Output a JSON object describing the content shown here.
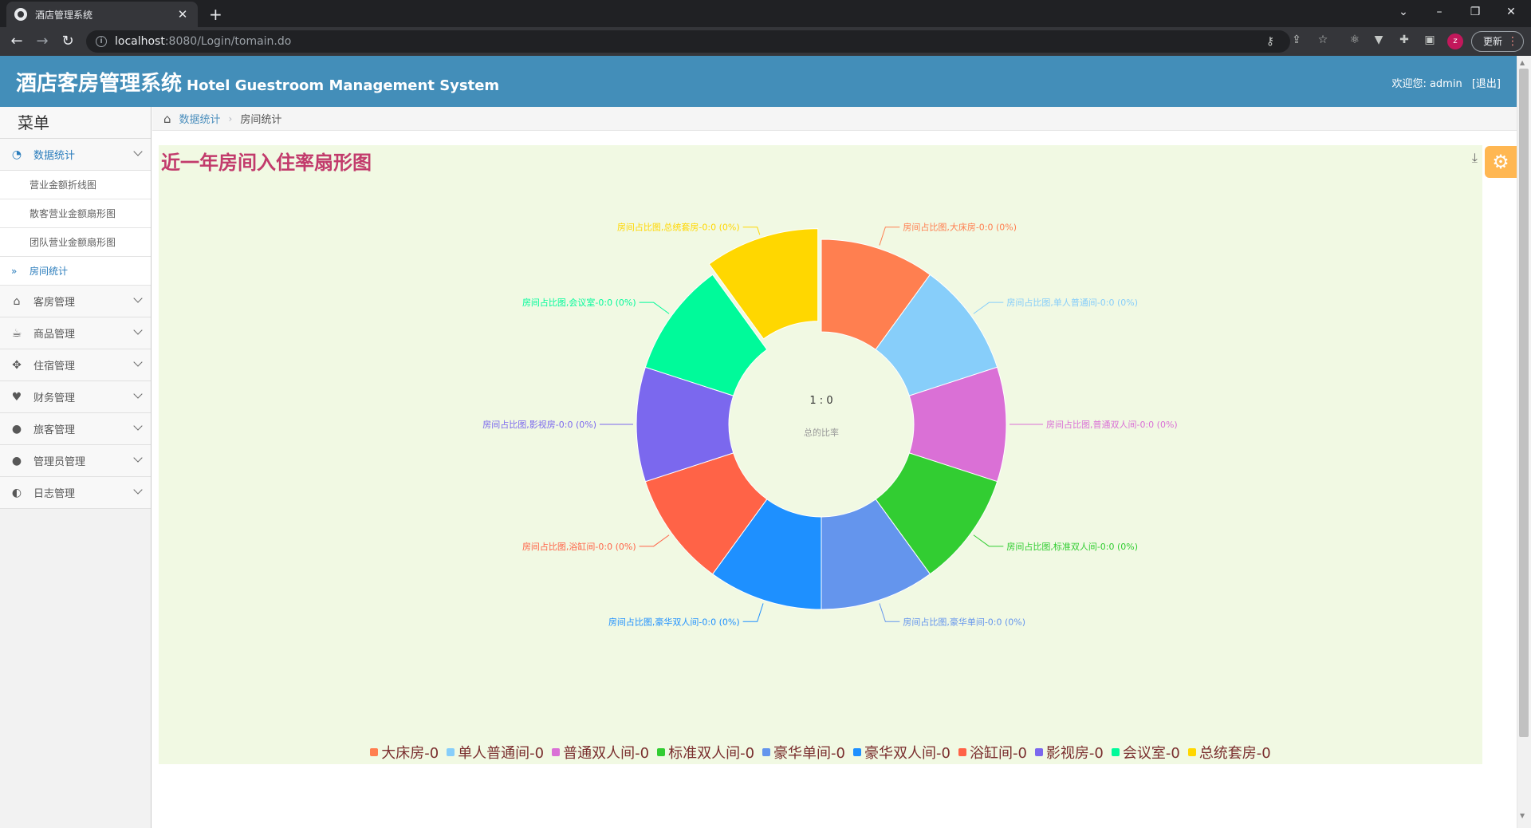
{
  "browser": {
    "tab_title": "酒店管理系统",
    "tab_close": "✕",
    "new_tab": "+",
    "url_host": "localhost",
    "url_path": ":8080/Login/tomain.do",
    "update_label": "更新",
    "profile_initial": "z"
  },
  "header": {
    "title": "酒店客房管理系统",
    "subtitle": "Hotel Guestroom Management System",
    "welcome": "欢迎您:",
    "username": "admin",
    "logout": "[退出]"
  },
  "sidebar": {
    "menu_title": "菜单",
    "items": [
      {
        "label": "数据统计",
        "icon": "dashboard-icon",
        "active": true
      },
      {
        "label": "客房管理",
        "icon": "home-icon"
      },
      {
        "label": "商品管理",
        "icon": "coffee-icon"
      },
      {
        "label": "住宿管理",
        "icon": "move-icon"
      },
      {
        "label": "财务管理",
        "icon": "heart-icon"
      },
      {
        "label": "旅客管理",
        "icon": "user-icon"
      },
      {
        "label": "管理员管理",
        "icon": "user-icon"
      },
      {
        "label": "日志管理",
        "icon": "adjust-icon"
      }
    ],
    "subitems": [
      {
        "label": "营业金额折线图"
      },
      {
        "label": "散客营业金额扇形图"
      },
      {
        "label": "团队营业金额扇形图"
      },
      {
        "label": "房间统计",
        "active": true
      }
    ]
  },
  "breadcrumb": {
    "home": "数据统计",
    "current": "房间统计"
  },
  "chart_data": {
    "type": "pie",
    "title": "近一年房间入住率扇形图",
    "center_text": "1 : 0",
    "center_subtext": "总的比率",
    "legend_position": "bottom",
    "label_prefix": "房间占比图,",
    "label_value": "0:0",
    "label_percent": "(0%)",
    "categories": [
      "大床房",
      "单人普通间",
      "普通双人间",
      "标准双人间",
      "豪华单间",
      "豪华双人间",
      "浴缸间",
      "影视房",
      "会议室",
      "总统套房"
    ],
    "values": [
      0,
      0,
      0,
      0,
      0,
      0,
      0,
      0,
      0,
      0
    ],
    "legend_labels": [
      "大床房-0",
      "单人普通间-0",
      "普通双人间-0",
      "标准双人间-0",
      "豪华单间-0",
      "豪华双人间-0",
      "浴缸间-0",
      "影视房-0",
      "会议室-0",
      "总统套房-0"
    ],
    "colors": [
      "#ff7f50",
      "#87cefa",
      "#da70d6",
      "#32cd32",
      "#6495ed",
      "#1e90ff",
      "#ff6347",
      "#7b68ee",
      "#00fa9a",
      "#ffd700"
    ],
    "exploded_slice": "总统套房"
  },
  "colors": {
    "header_bg": "#438eb9",
    "title_color": "#c23b6c",
    "panel_bg": "#f1f9e3",
    "settings_btn": "#ffb752"
  }
}
